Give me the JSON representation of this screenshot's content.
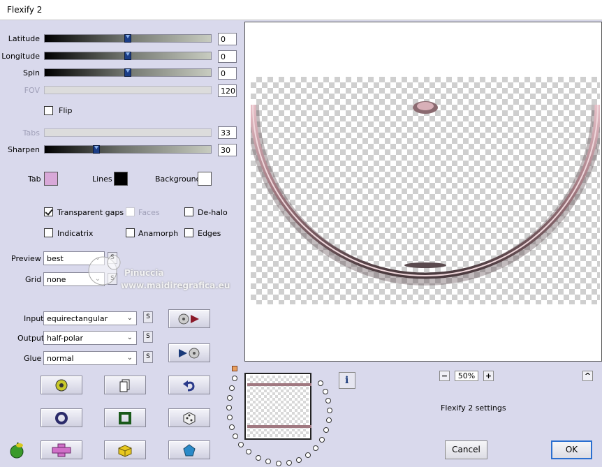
{
  "window": {
    "title": "Flexify 2"
  },
  "sliders": {
    "latitude": {
      "label": "Latitude",
      "value": "0",
      "position": 0.5
    },
    "longitude": {
      "label": "Longitude",
      "value": "0",
      "position": 0.5
    },
    "spin": {
      "label": "Spin",
      "value": "0",
      "position": 0.5
    },
    "fov": {
      "label": "FOV",
      "value": "120"
    },
    "tabs": {
      "label": "Tabs",
      "value": "33"
    },
    "sharpen": {
      "label": "Sharpen",
      "value": "30",
      "position": 0.3
    }
  },
  "flip": {
    "label": "Flip",
    "checked": false
  },
  "colors": {
    "tab": {
      "label": "Tab",
      "color": "#d8a8d8"
    },
    "lines": {
      "label": "Lines",
      "color": "#000000"
    },
    "background": {
      "label": "Background",
      "color": "#ffffff"
    }
  },
  "options": {
    "transparent_gaps": {
      "label": "Transparent gaps",
      "checked": true
    },
    "faces": {
      "label": "Faces",
      "checked": false,
      "disabled": true
    },
    "de_halo": {
      "label": "De-halo",
      "checked": false
    },
    "indicatrix": {
      "label": "Indicatrix",
      "checked": false
    },
    "anamorph": {
      "label": "Anamorph",
      "checked": false
    },
    "edges": {
      "label": "Edges",
      "checked": false
    }
  },
  "preview_select": {
    "label": "Preview",
    "value": "best"
  },
  "grid_select": {
    "label": "Grid",
    "value": "none"
  },
  "input_select": {
    "label": "Input",
    "value": "equirectangular"
  },
  "output_select": {
    "label": "Output",
    "value": "half-polar"
  },
  "glue_select": {
    "label": "Glue",
    "value": "normal"
  },
  "s_label": "S",
  "watermark": {
    "name": "Pinuccia",
    "url": "www.maidiregrafica.eu"
  },
  "zoom": {
    "value": "50%",
    "minus": "−",
    "plus": "+"
  },
  "collapse_label": "^",
  "info_label": "i",
  "settings_label": "Flexify 2 settings",
  "buttons": {
    "cancel": "Cancel",
    "ok": "OK"
  }
}
